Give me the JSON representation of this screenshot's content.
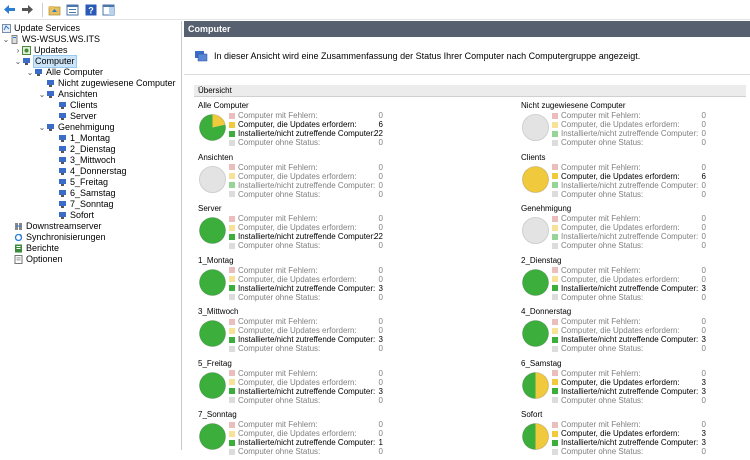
{
  "colors": {
    "error": "#d98585",
    "needed": "#f0c93c",
    "installed": "#3cae3c",
    "nostatus": "#c8c8c8",
    "header_bg": "#57606e"
  },
  "toolbar": {
    "icons": [
      "back-arrow-icon",
      "forward-arrow-icon",
      "up-folder-icon",
      "console-tree-icon",
      "help-icon",
      "panel-icon"
    ]
  },
  "tree": {
    "root": "Update Services",
    "server": "WS-WSUS.WS.ITS",
    "updates": "Updates",
    "computers": "Computer",
    "all_computers": "Alle Computer",
    "unassigned": "Nicht zugewiesene Computer",
    "ansichten": "Ansichten",
    "clients": "Clients",
    "server_grp": "Server",
    "genehmigung": "Genehmigung",
    "days": [
      "1_Montag",
      "2_Dienstag",
      "3_Mittwoch",
      "4_Donnerstag",
      "5_Freitag",
      "6_Samstag",
      "7_Sonntag",
      "Sofort"
    ],
    "downstream": "Downstreamserver",
    "sync": "Synchronisierungen",
    "reports": "Berichte",
    "options": "Optionen"
  },
  "main": {
    "header": "Computer",
    "description": "In dieser Ansicht wird eine Zusammenfassung der Status Ihrer Computer nach Computergruppe angezeigt.",
    "overview": "Übersicht"
  },
  "status_labels": {
    "errors": "Computer mit Fehlern:",
    "needed": "Computer, die Updates erfordern:",
    "installed": "Installierte/nicht zutreffende Computer:",
    "nostatus": "Computer ohne Status:"
  },
  "groups": [
    {
      "name": "Alle Computer",
      "errors": 0,
      "needed": 6,
      "installed": 22,
      "nostatus": 0
    },
    {
      "name": "Nicht zugewiesene Computer",
      "errors": 0,
      "needed": 0,
      "installed": 0,
      "nostatus": 0
    },
    {
      "name": "Ansichten",
      "errors": 0,
      "needed": 0,
      "installed": 0,
      "nostatus": 0
    },
    {
      "name": "Clients",
      "errors": 0,
      "needed": 6,
      "installed": 0,
      "nostatus": 0
    },
    {
      "name": "Server",
      "errors": 0,
      "needed": 0,
      "installed": 22,
      "nostatus": 0
    },
    {
      "name": "Genehmigung",
      "errors": 0,
      "needed": 0,
      "installed": 0,
      "nostatus": 0
    },
    {
      "name": "1_Montag",
      "errors": 0,
      "needed": 0,
      "installed": 3,
      "nostatus": 0
    },
    {
      "name": "2_Dienstag",
      "errors": 0,
      "needed": 0,
      "installed": 3,
      "nostatus": 0
    },
    {
      "name": "3_Mittwoch",
      "errors": 0,
      "needed": 0,
      "installed": 3,
      "nostatus": 0
    },
    {
      "name": "4_Donnerstag",
      "errors": 0,
      "needed": 0,
      "installed": 3,
      "nostatus": 0
    },
    {
      "name": "5_Freitag",
      "errors": 0,
      "needed": 0,
      "installed": 3,
      "nostatus": 0
    },
    {
      "name": "6_Samstag",
      "errors": 0,
      "needed": 3,
      "installed": 3,
      "nostatus": 0
    },
    {
      "name": "7_Sonntag",
      "errors": 0,
      "needed": 0,
      "installed": 1,
      "nostatus": 0
    },
    {
      "name": "Sofort",
      "errors": 0,
      "needed": 3,
      "installed": 3,
      "nostatus": 0
    }
  ]
}
